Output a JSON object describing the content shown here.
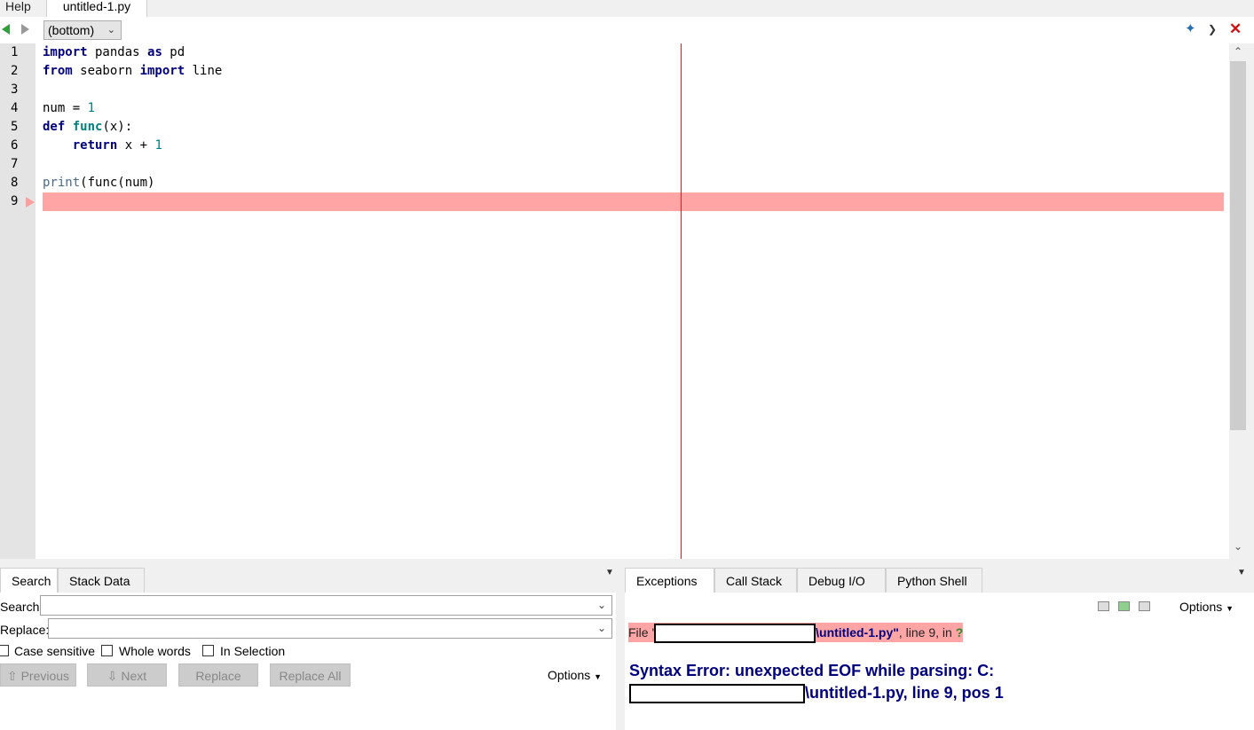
{
  "top_tabs": {
    "help": "Help",
    "file": "untitled-1.py"
  },
  "toolbar": {
    "scope": "(bottom)"
  },
  "editor": {
    "line_numbers": [
      "1",
      "2",
      "3",
      "4",
      "5",
      "6",
      "7",
      "8",
      "9"
    ],
    "lines": {
      "l1": {
        "kw1": "import",
        "t1": " pandas ",
        "kw2": "as",
        "t2": " pd"
      },
      "l2": {
        "kw1": "from",
        "t1": " seaborn ",
        "kw2": "import",
        "t2": " line"
      },
      "l4": {
        "t1": "num = ",
        "num": "1"
      },
      "l5": {
        "kw1": "def",
        "t0": " ",
        "fn": "func",
        "t1": "(x):"
      },
      "l6": {
        "indent": "    ",
        "kw1": "return",
        "t1": " x + ",
        "num": "1"
      },
      "l8": {
        "bi": "print",
        "t1": "(func(num)"
      }
    },
    "error_line": 9
  },
  "left_panel": {
    "tabs": [
      "Search",
      "Stack Data"
    ],
    "search_label": "Search:",
    "replace_label": "Replace:",
    "search_value": "",
    "replace_value": "",
    "checkboxes": [
      "Case sensitive",
      "Whole words",
      "In Selection"
    ],
    "buttons": {
      "previous": "Previous",
      "next": "Next",
      "replace": "Replace",
      "replace_all": "Replace All"
    },
    "options": "Options"
  },
  "right_panel": {
    "tabs": [
      "Exceptions",
      "Call Stack",
      "Debug I/O",
      "Python Shell"
    ],
    "options": "Options",
    "exception": {
      "file_prefix": "File '",
      "file_name": "\\untitled-1.py\"",
      "file_suffix": ", line 9, in ",
      "file_q": "?",
      "message_line1": "Syntax Error: unexpected EOF while parsing: C:",
      "message_line2": "\\untitled-1.py, line 9, pos 1"
    }
  },
  "colors": {
    "error_highlight": "#ffa5a5",
    "edge_line": "#e02020",
    "keyword": "#00007f",
    "function": "#007f7f"
  }
}
